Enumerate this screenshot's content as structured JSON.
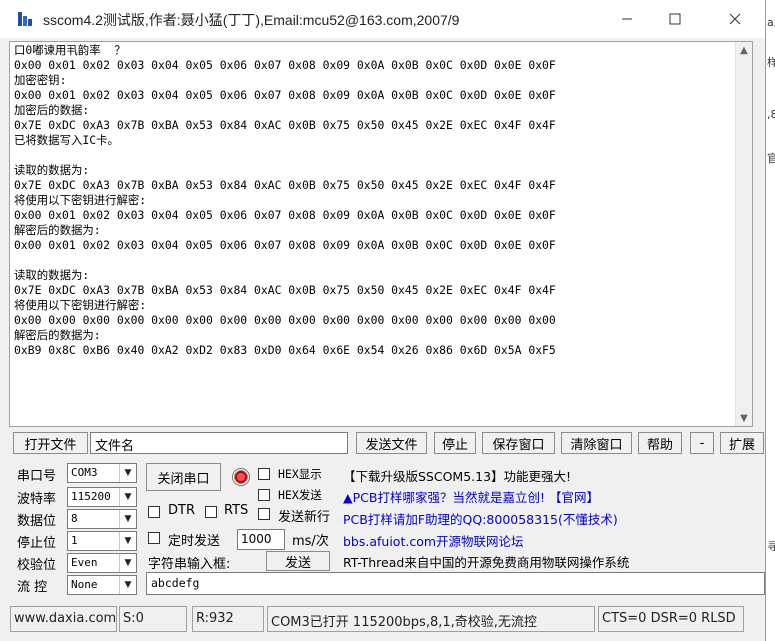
{
  "window": {
    "title": "sscom4.2测试版,作者:聂小猛(丁丁),Email:mcu52@163.com,2007/9"
  },
  "output": {
    "lines": [
      "口0嘟谏用丮韵率  ？",
      "0x00 0x01 0x02 0x03 0x04 0x05 0x06 0x07 0x08 0x09 0x0A 0x0B 0x0C 0x0D 0x0E 0x0F",
      "加密密钥:",
      "0x00 0x01 0x02 0x03 0x04 0x05 0x06 0x07 0x08 0x09 0x0A 0x0B 0x0C 0x0D 0x0E 0x0F",
      "加密后的数据:",
      "0x7E 0xDC 0xA3 0x7B 0xBA 0x53 0x84 0xAC 0x0B 0x75 0x50 0x45 0x2E 0xEC 0x4F 0x4F",
      "已将数据写入IC卡。",
      "",
      "读取的数据为:",
      "0x7E 0xDC 0xA3 0x7B 0xBA 0x53 0x84 0xAC 0x0B 0x75 0x50 0x45 0x2E 0xEC 0x4F 0x4F",
      "将使用以下密钥进行解密:",
      "0x00 0x01 0x02 0x03 0x04 0x05 0x06 0x07 0x08 0x09 0x0A 0x0B 0x0C 0x0D 0x0E 0x0F",
      "解密后的数据为:",
      "0x00 0x01 0x02 0x03 0x04 0x05 0x06 0x07 0x08 0x09 0x0A 0x0B 0x0C 0x0D 0x0E 0x0F",
      "",
      "读取的数据为:",
      "0x7E 0xDC 0xA3 0x7B 0xBA 0x53 0x84 0xAC 0x0B 0x75 0x50 0x45 0x2E 0xEC 0x4F 0x4F",
      "将使用以下密钥进行解密:",
      "0x00 0x00 0x00 0x00 0x00 0x00 0x00 0x00 0x00 0x00 0x00 0x00 0x00 0x00 0x00 0x00",
      "解密后的数据为:",
      "0xB9 0x8C 0xB6 0x40 0xA2 0xD2 0x83 0xD0 0x64 0x6E 0x54 0x26 0x86 0x6D 0x5A 0xF5"
    ]
  },
  "toolbar": {
    "open_file": "打开文件",
    "file_name": "文件名",
    "send_file": "发送文件",
    "stop": "停止",
    "save_window": "保存窗口",
    "clear_window": "清除窗口",
    "help": "帮助",
    "collapse": "-",
    "expand": "扩展"
  },
  "settings": {
    "port_label": "串口号",
    "port_value": "COM3",
    "baud_label": "波特率",
    "baud_value": "115200",
    "databits_label": "数据位",
    "databits_value": "8",
    "stopbits_label": "停止位",
    "stopbits_value": "1",
    "parity_label": "校验位",
    "parity_value": "Even",
    "flow_label": "流 控",
    "flow_value": "None",
    "close_port": "关闭串口",
    "hex_display": "HEX显示",
    "hex_send": "HEX发送",
    "send_newline": "发送新行",
    "dtr": "DTR",
    "rts": "RTS",
    "timed_send": "定时发送",
    "interval": "1000",
    "interval_unit": "ms/次",
    "input_label": "字符串输入框:",
    "send": "发送",
    "send_text": "abcdefg"
  },
  "info": {
    "line1": "【下载升级版SSCOM5.13】功能更强大!",
    "line2": "▲PCB打样哪家强？当然就是嘉立创! 【官网】",
    "line3": "PCB打样请加F助理的QQ:800058315(不懂技术)",
    "line4": "bbs.afuiot.com开源物联网论坛",
    "line5": "RT-Thread来自中国的开源免费商用物联网操作系统"
  },
  "status": {
    "website": "www.daxia.com",
    "sent": "S:0",
    "received": "R:932",
    "port_status": "COM3已打开  115200bps,8,1,奇校验,无流控",
    "line_status": "CTS=0 DSR=0 RLSD"
  },
  "colors": {
    "link_blue": "#0000d8"
  }
}
